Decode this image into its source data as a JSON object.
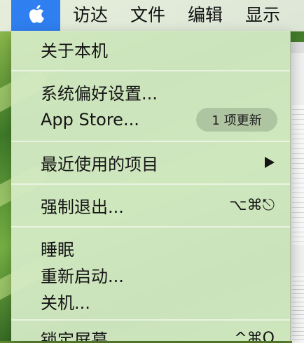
{
  "menubar": {
    "apple_menu_icon": "apple-logo",
    "items": [
      "访达",
      "文件",
      "编辑",
      "显示"
    ]
  },
  "apple_menu": {
    "about": "关于本机",
    "system_prefs": "系统偏好设置...",
    "app_store": "App Store...",
    "app_store_badge": "1 项更新",
    "recent_items": "最近使用的项目",
    "force_quit": "强制退出...",
    "force_quit_shortcut": "⌥⌘⎋",
    "sleep": "睡眠",
    "restart": "重新启动...",
    "shutdown": "关机...",
    "lock_screen": "锁定屏幕",
    "lock_screen_shortcut": "^⌘Q"
  },
  "colors": {
    "menubar_highlight": "#2f7ff0",
    "menu_background": "#d4eac4"
  }
}
